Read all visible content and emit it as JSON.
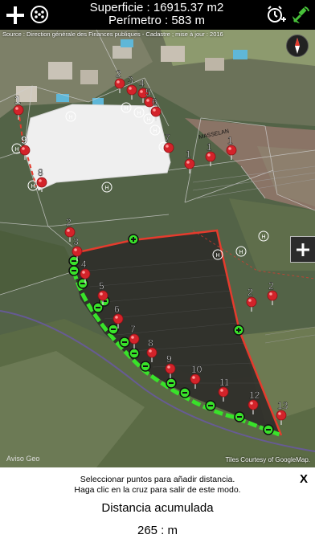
{
  "header": {
    "area_label": "Superficie : 16915.37 m2",
    "perimeter_label": "Perímetro : 583 m"
  },
  "map": {
    "source_text": "Source : Direction générale des Finances publiques - Cadastre ; mise à jour : 2016",
    "attribution": "Tiles Courtesy of GoogleMap.",
    "logo_text": "Aviso Geo",
    "road_label": "MASSELAN",
    "pin_labels": [
      "1",
      "9",
      "8",
      "2",
      "3",
      "4",
      "5",
      "6",
      "7",
      "8",
      "9",
      "10",
      "11",
      "12",
      "13",
      "2",
      "3",
      "4",
      "5",
      "6",
      "7",
      "1",
      "1",
      "1",
      "2",
      "2"
    ]
  },
  "panel": {
    "instruction_line1": "Seleccionar puntos para añadir distancia.",
    "instruction_line2": "Haga clic en la cruz para salir de este modo.",
    "close_label": "X",
    "distance_title": "Distancia acumulada",
    "distance_value": "265 : m"
  },
  "colors": {
    "polygon_edge": "#e53b2d",
    "selected_edge": "#39e22a",
    "field_white": "#f0f0f0"
  }
}
